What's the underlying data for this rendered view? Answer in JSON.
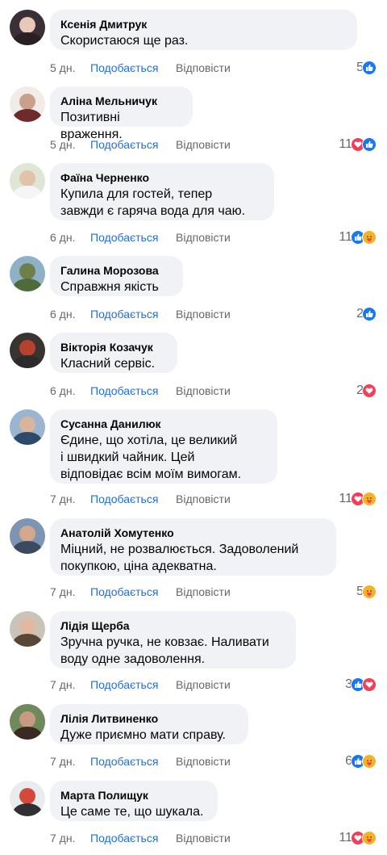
{
  "labels": {
    "like": "Подобається",
    "reply": "Відповісти"
  },
  "colors": {
    "link": "#216fdb",
    "meta": "#65676b",
    "bubble": "#f0f2f5",
    "like": "#1877f2",
    "love": "#f33e58",
    "care": "#f7b125"
  },
  "comments": [
    {
      "author": "Ксенія Дмитрук",
      "text": "Скористаюся ще раз.",
      "time": "5 дн.",
      "count": "5",
      "reactions": [
        "like-icon"
      ]
    },
    {
      "author": "Аліна Мельничук",
      "text": "Позитивні враження.",
      "time": "5 дн.",
      "count": "11",
      "reactions": [
        "love-icon",
        "like-icon"
      ]
    },
    {
      "author": "Фаїна Черненко",
      "text": "Купила для гостей, тепер\nзавжди є гаряча вода для чаю.",
      "time": "6 дн.",
      "count": "11",
      "reactions": [
        "like-icon",
        "care-icon"
      ]
    },
    {
      "author": "Галина Морозова",
      "text": "Справжня якість",
      "time": "6 дн.",
      "count": "2",
      "reactions": [
        "like-icon"
      ]
    },
    {
      "author": "Вікторія Козачук",
      "text": "Класний сервіс.",
      "time": "6 дн.",
      "count": "2",
      "reactions": [
        "love-icon"
      ]
    },
    {
      "author": "Сусанна Данилюк",
      "text": "Єдине, що хотіла, це великий\nі швидкий чайник. Цей\nвідповідає всім моїм вимогам.",
      "time": "7 дн.",
      "count": "11",
      "reactions": [
        "love-icon",
        "care-icon"
      ]
    },
    {
      "author": "Анатолій Хомутенко",
      "text": "Міцний, не розвалюється. Задоволений\nпокупкою, ціна адекватна.",
      "time": "7 дн.",
      "count": "5",
      "reactions": [
        "care-icon"
      ]
    },
    {
      "author": "Лідія Щерба",
      "text": "Зручна ручка, не ковзає. Наливати\nводу одне задоволення.",
      "time": "7 дн.",
      "count": "3",
      "reactions": [
        "like-icon",
        "love-icon"
      ]
    },
    {
      "author": "Лілія Литвиненко",
      "text": "Дуже приємно мати справу.",
      "time": "7 дн.",
      "count": "6",
      "reactions": [
        "like-icon",
        "care-icon"
      ]
    },
    {
      "author": "Марта Полищук",
      "text": "Це саме те, що шукала.",
      "time": "7 дн.",
      "count": "11",
      "reactions": [
        "love-icon",
        "care-icon"
      ]
    }
  ]
}
